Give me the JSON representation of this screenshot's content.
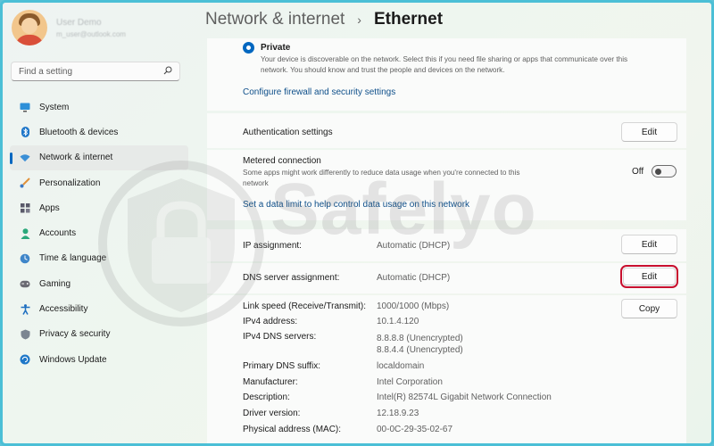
{
  "window": {
    "breadcrumb": "Network & internet",
    "separator": "›",
    "page_title": "Ethernet"
  },
  "user": {
    "name": "User Demo",
    "email": "m_user@outlook.com"
  },
  "search": {
    "placeholder": "Find a setting",
    "icon": "search-icon"
  },
  "sidebar": {
    "items": [
      {
        "label": "System",
        "icon": "monitor-icon",
        "active": false
      },
      {
        "label": "Bluetooth & devices",
        "icon": "bluetooth-icon",
        "active": false
      },
      {
        "label": "Network & internet",
        "icon": "wifi-icon",
        "active": true
      },
      {
        "label": "Personalization",
        "icon": "brush-icon",
        "active": false
      },
      {
        "label": "Apps",
        "icon": "apps-icon",
        "active": false
      },
      {
        "label": "Accounts",
        "icon": "person-icon",
        "active": false
      },
      {
        "label": "Time & language",
        "icon": "globe-clock-icon",
        "active": false
      },
      {
        "label": "Gaming",
        "icon": "controller-icon",
        "active": false
      },
      {
        "label": "Accessibility",
        "icon": "accessibility-icon",
        "active": false
      },
      {
        "label": "Privacy & security",
        "icon": "shield-icon",
        "active": false
      },
      {
        "label": "Windows Update",
        "icon": "update-icon",
        "active": false
      }
    ]
  },
  "network_profile": {
    "private_label": "Private",
    "private_desc_1": "Your device is discoverable on the network. Select this if you need file sharing or apps that communicate over this",
    "private_desc_2": "network. You should know and trust the people and devices on the network.",
    "firewall_link": "Configure firewall and security settings"
  },
  "authentication": {
    "label": "Authentication settings",
    "button": "Edit"
  },
  "metered": {
    "label": "Metered connection",
    "desc_1": "Some apps might work differently to reduce data usage when you're connected to this",
    "desc_2": "network",
    "toggle_label": "Off",
    "data_limit_link": "Set a data limit to help control data usage on this network"
  },
  "ip": {
    "label": "IP assignment:",
    "value": "Automatic (DHCP)",
    "button": "Edit"
  },
  "dns": {
    "label": "DNS server assignment:",
    "value": "Automatic (DHCP)",
    "button": "Edit"
  },
  "properties": {
    "copy_button": "Copy",
    "rows": [
      {
        "key": "Link speed (Receive/Transmit):",
        "value": "1000/1000 (Mbps)"
      },
      {
        "key": "IPv4 address:",
        "value": "10.1.4.120"
      },
      {
        "key": "IPv4 DNS servers:",
        "value": "8.8.8.8 (Unencrypted)",
        "value2": "8.8.4.4 (Unencrypted)"
      },
      {
        "key": "Primary DNS suffix:",
        "value": "localdomain"
      },
      {
        "key": "Manufacturer:",
        "value": "Intel Corporation"
      },
      {
        "key": "Description:",
        "value": "Intel(R) 82574L Gigabit Network Connection"
      },
      {
        "key": "Driver version:",
        "value": "12.18.9.23"
      },
      {
        "key": "Physical address (MAC):",
        "value": "00-0C-29-35-02-67"
      }
    ]
  },
  "watermark": {
    "text": "Safelyo",
    "icon": "lock-shield-logo"
  },
  "colors": {
    "accent": "#0067c0",
    "highlight_box": "#c8102e",
    "link": "#0e4f8a"
  }
}
